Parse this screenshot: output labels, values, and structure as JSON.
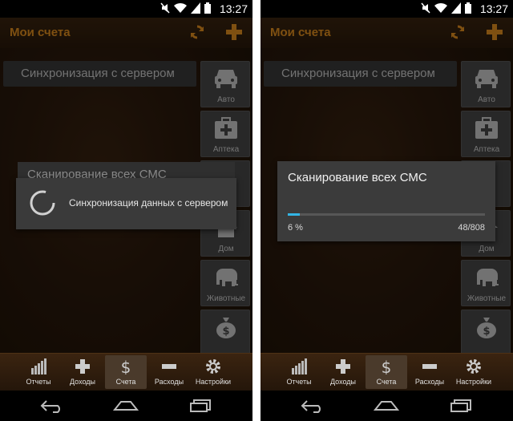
{
  "status_bar": {
    "time": "13:27"
  },
  "app": {
    "title": "Мои счета"
  },
  "sync_row": {
    "label": "Синхронизация с сервером"
  },
  "categories": [
    {
      "label": "Авто",
      "icon": "car-icon"
    },
    {
      "label": "Аптека",
      "icon": "first-aid-icon"
    },
    {
      "label": "",
      "icon": "category-icon"
    },
    {
      "label": "Дом",
      "icon": "house-icon"
    },
    {
      "label": "Животные",
      "icon": "elephant-icon"
    },
    {
      "label": "",
      "icon": "money-bag-icon"
    }
  ],
  "tabs": [
    {
      "label": "Отчеты",
      "icon": "bar-chart-icon"
    },
    {
      "label": "Доходы",
      "icon": "plus-icon"
    },
    {
      "label": "Счета",
      "icon": "dollar-icon",
      "active": true
    },
    {
      "label": "Расходы",
      "icon": "minus-icon"
    },
    {
      "label": "Настройки",
      "icon": "gear-icon"
    }
  ],
  "left_screen": {
    "background_text": "Сканирование всех СМС",
    "dialog_message": "Синхронизация данных с сервером"
  },
  "right_screen": {
    "dialog_title": "Сканирование всех СМС",
    "progress_percent_label": "6 %",
    "progress_count": "48/808",
    "progress_value": 0.06
  },
  "colors": {
    "accent": "#e8921f",
    "progress": "#33b5e5"
  }
}
